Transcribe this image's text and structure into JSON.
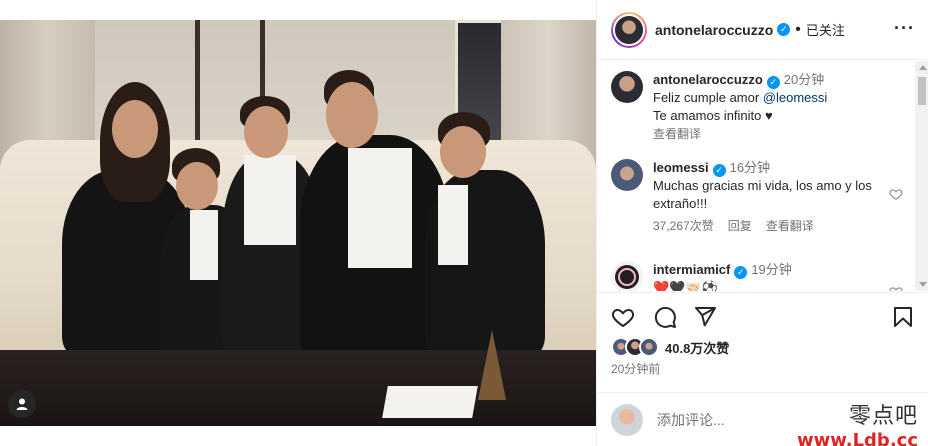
{
  "post": {
    "author": "antonelaroccuzzo",
    "follow_status": "已关注",
    "more": "···"
  },
  "comments": [
    {
      "user": "antonelaroccuzzo",
      "time": "20分钟",
      "line1_prefix": "Feliz cumple amor ",
      "mention": "@leomessi",
      "line2": "Te amamos infinito ♥",
      "see_translation": "查看翻译"
    },
    {
      "user": "leomessi",
      "time": "16分钟",
      "text": "Muchas gracias mi vida, los amo y los extraño!!!",
      "likes": "37,267次赞",
      "reply": "回复",
      "see_translation": "查看翻译"
    },
    {
      "user": "intermiamicf",
      "time": "19分钟",
      "text": "❤️🖤🤝🏻⚽"
    }
  ],
  "likes": "40.8万次赞",
  "post_time": "20分钟前",
  "add_comment_placeholder": "添加评论...",
  "watermark": {
    "top": "零点吧",
    "url": "www.Ldb.cc"
  },
  "icons": {
    "like": "heart-icon",
    "comment": "comment-icon",
    "share": "paper-plane-icon",
    "save": "bookmark-icon",
    "tags": "user-tag-icon",
    "verified": "verified-badge-icon"
  },
  "colors": {
    "verified": "#0095f6",
    "watermark_url": "#e02424",
    "secondary_text": "#737373"
  }
}
